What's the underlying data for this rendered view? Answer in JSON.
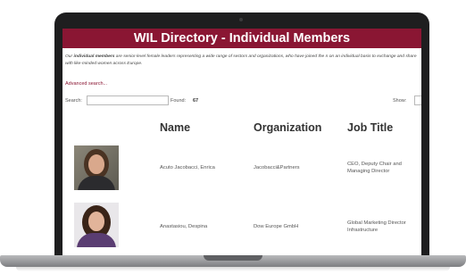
{
  "directory": {
    "title": "WIL Directory - Individual Members",
    "intro_bold": "individual members",
    "intro_before": "Our ",
    "intro_after": " are senior-level female leaders representing a wide range of sectors and organizations, who have joined the n on an individual basis to exchange and share with like-minded women across Europe.",
    "advanced_search": "Advanced search...",
    "search_label": "Search:",
    "search_value": "",
    "found_label": "Found:",
    "found_count": "67",
    "show_label": "Show:"
  },
  "table": {
    "headers": {
      "name": "Name",
      "organization": "Organization",
      "job_title": "Job Title"
    },
    "rows": [
      {
        "name": "Acuto Jacobacci, Enrica",
        "organization": "Jacobacci&Partners",
        "job_title": "CEO, Deputy Chair and Managing Director"
      },
      {
        "name": "Anastasiou, Despina",
        "organization": "Dow Europe GmbH",
        "job_title": "Global Marketing Director Infrastructure"
      }
    ]
  },
  "colors": {
    "brand": "#8a1633",
    "laptop": "#1e1e1f"
  }
}
